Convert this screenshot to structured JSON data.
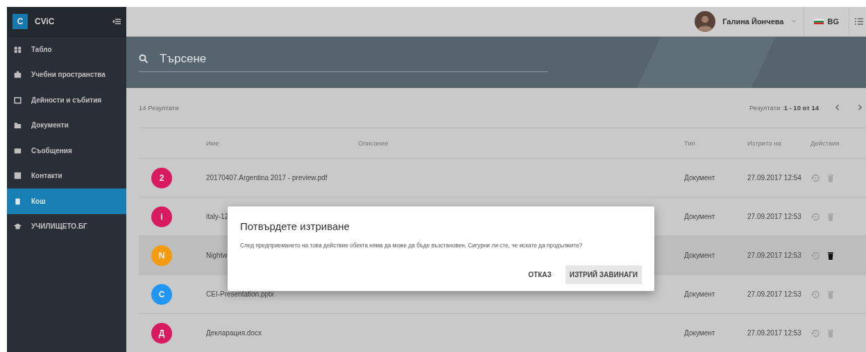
{
  "app": {
    "logo_letter": "C",
    "name": "CViC"
  },
  "sidebar": {
    "items": [
      {
        "label": "Табло",
        "selected": false
      },
      {
        "label": "Учебни пространства",
        "selected": false
      },
      {
        "label": "Дейности и събития",
        "selected": false
      },
      {
        "label": "Документи",
        "selected": false
      },
      {
        "label": "Съобщения",
        "selected": false
      },
      {
        "label": "Контакти",
        "selected": false
      },
      {
        "label": "Кош",
        "selected": true
      },
      {
        "label": "УЧИЛИЩЕТО.БГ",
        "selected": false
      }
    ]
  },
  "user": {
    "name": "Галина Йончева"
  },
  "language": {
    "code": "BG"
  },
  "search": {
    "placeholder": "Търсене"
  },
  "results": {
    "count": "14 Резултати",
    "range": "Резултати :**1 - 10 от 14**"
  },
  "table": {
    "columns": [
      "Име",
      "Описание",
      "Тип",
      "Изтрито на",
      "Действия"
    ],
    "rows": [
      {
        "initial": "2",
        "color": "#d81b60",
        "name": "20170407.Argentina 2017 - preview.pdf",
        "type": "Документ",
        "deleted": "27.09.2017 12:54",
        "highlighted": false
      },
      {
        "initial": "i",
        "color": "#d81b60",
        "name": "italy-12",
        "type": "Документ",
        "deleted": "27.09.2017 12:53",
        "highlighted": false
      },
      {
        "initial": "N",
        "color": "#f39c12",
        "name": "Nightw",
        "type": "Документ",
        "deleted": "27.09.2017 12:53",
        "highlighted": true
      },
      {
        "initial": "C",
        "color": "#2196f3",
        "name": "CEI-Presentation.pptx",
        "type": "Документ",
        "deleted": "27.09.2017 12:53",
        "highlighted": false
      },
      {
        "initial": "Д",
        "color": "#d81b60",
        "name": "Декларация.docx",
        "type": "Документ",
        "deleted": "27.09.2017 12:53",
        "highlighted": false
      }
    ]
  },
  "dialog": {
    "title": "Потвърдете изтриване",
    "message": "След предприемането на това действие обекта няма да може да бъде възстановен. Сигурни ли сте, че искате да продължите?",
    "buttons": [
      {
        "label": "ОТКАЗ",
        "kind": "flat"
      },
      {
        "label": "ИЗТРИЙ ЗАВИНАГИ",
        "kind": "raised"
      }
    ]
  }
}
